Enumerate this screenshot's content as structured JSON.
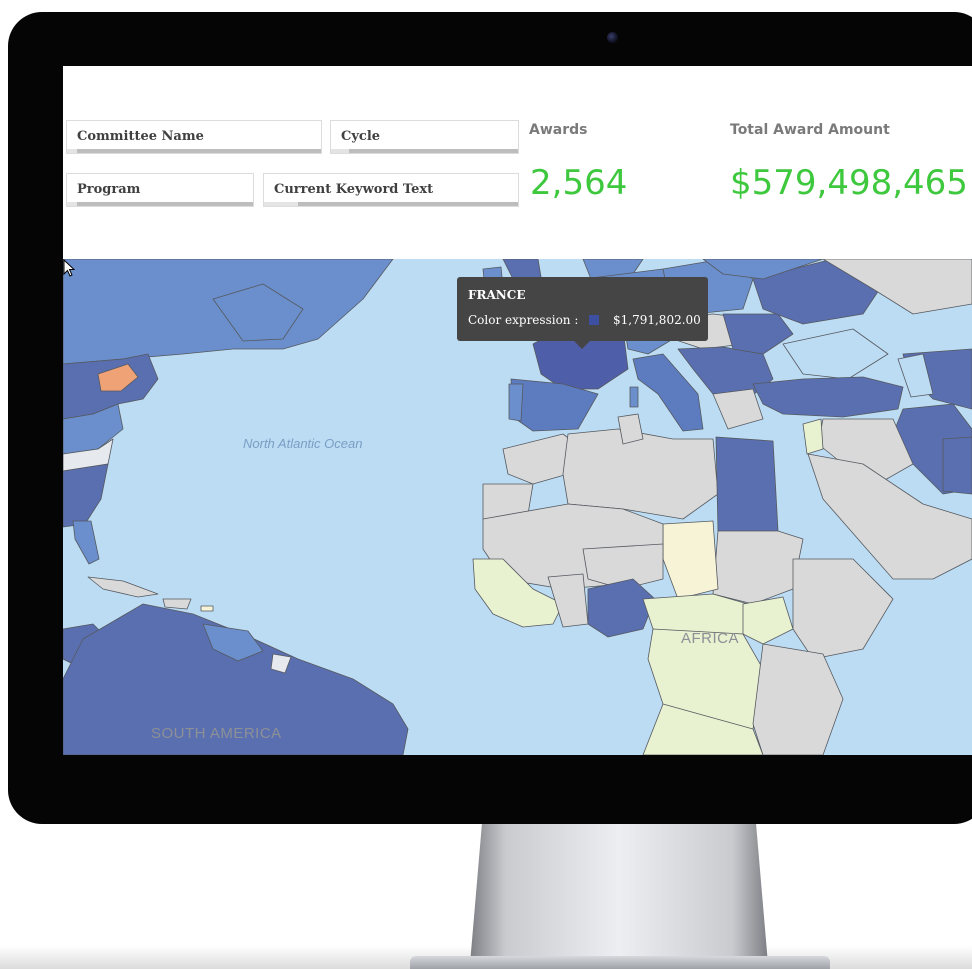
{
  "filters": {
    "committee_name": "Committee Name",
    "cycle": "Cycle",
    "program": "Program",
    "current_keyword_text": "Current Keyword Text"
  },
  "kpis": {
    "awards_label": "Awards",
    "awards_value": "2,564",
    "total_label": "Total Award Amount",
    "total_value": "$579,498,465"
  },
  "map": {
    "ocean_label": "North Atlantic Ocean",
    "africa_label": "AFRICA",
    "south_america_label": "SOUTH AMERICA",
    "tooltip": {
      "country": "FRANCE",
      "measure_label": "Color expression :",
      "measure_value": "$1,791,802.00"
    }
  },
  "colors": {
    "kpi_green": "#3ec83e",
    "water": "#bcdcf4",
    "funded_high": "#5a6fb0",
    "funded_mid": "#6b8fcc",
    "highlight_state": "#f0a277",
    "no_data_land": "#d9d9d9",
    "tooltip_bg": "#454545",
    "swatch": "#3d4fa0"
  },
  "icons": {
    "cursor": "arrow-cursor-icon",
    "camera": "webcam-icon"
  }
}
